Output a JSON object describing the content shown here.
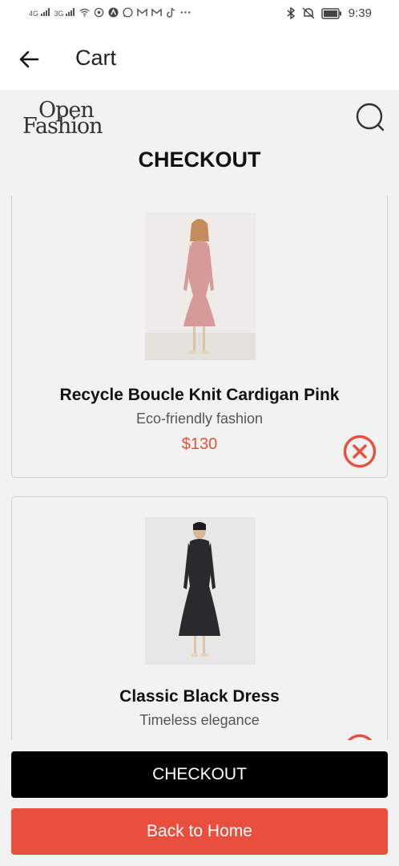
{
  "status_bar": {
    "signal_1": "4G",
    "signal_2": "3G",
    "time": "9:39",
    "icons": [
      "signal-icon",
      "signal-icon",
      "wifi-icon",
      "hotspot-icon",
      "app-icon",
      "whatsapp-icon",
      "gmail-icon",
      "gmail-icon",
      "tiktok-icon",
      "more-icon",
      "bluetooth-icon",
      "mute-icon",
      "battery-icon"
    ]
  },
  "app_bar": {
    "back_icon": "arrow-left-icon",
    "title": "Cart"
  },
  "header": {
    "logo_line1": "Open",
    "logo_line2": "Fashion",
    "search_icon": "search-icon",
    "heading": "CHECKOUT"
  },
  "cart_items": [
    {
      "name": "Recycle Boucle Knit Cardigan Pink",
      "subtitle": "Eco-friendly fashion",
      "price": "$130",
      "remove_icon": "close-circle-icon"
    },
    {
      "name": "Classic Black Dress",
      "subtitle": "Timeless elegance",
      "remove_icon": "close-circle-icon"
    }
  ],
  "actions": {
    "checkout_label": "CHECKOUT",
    "home_label": "Back to Home"
  },
  "colors": {
    "accent": "#e84f3d",
    "primary_button": "#000000",
    "background": "#f2f2f2"
  }
}
